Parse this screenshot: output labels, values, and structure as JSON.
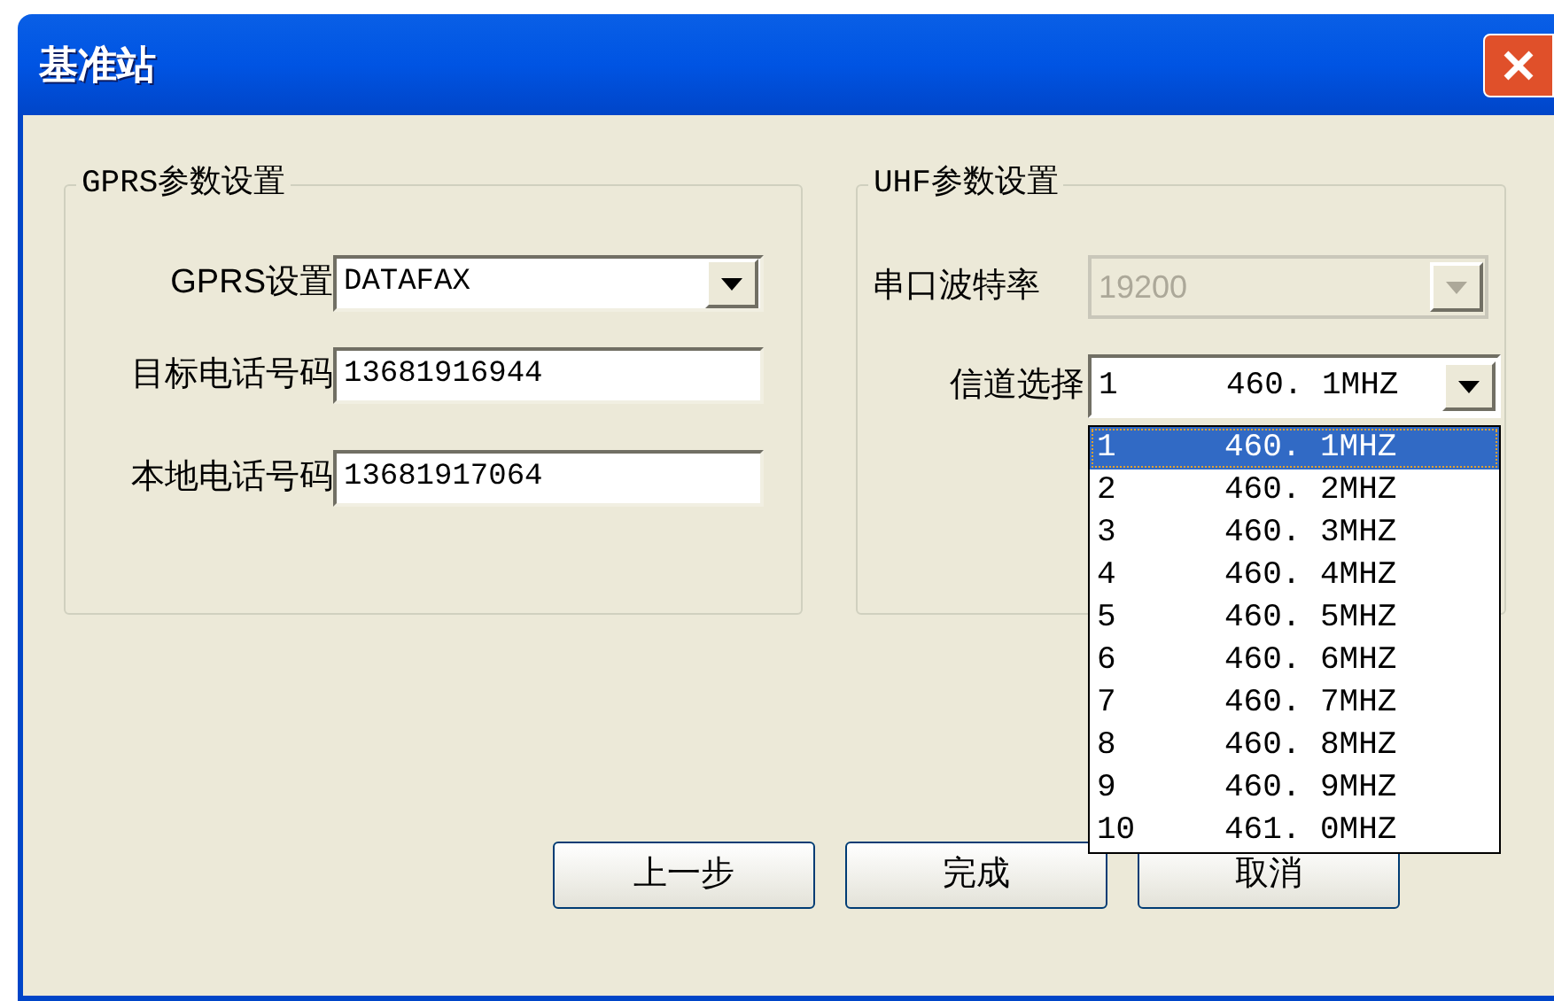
{
  "window": {
    "title": "基准站"
  },
  "gprs_group": {
    "title": "GPRS参数设置",
    "fields": [
      {
        "kind": "dropdown",
        "label": "GPRS设置",
        "value": "DATAFAX"
      },
      {
        "kind": "text",
        "label": "目标电话号码",
        "value": "13681916944"
      },
      {
        "kind": "text",
        "label": "本地电话号码",
        "value": "13681917064"
      }
    ]
  },
  "uhf_group": {
    "title": "UHF参数设置",
    "baud_rate": {
      "label": "串口波特率",
      "value": "19200",
      "disabled": true
    },
    "channel": {
      "label": "信道选择",
      "number": "1",
      "frequency": "460. 1MHZ",
      "expanded": true,
      "options": [
        {
          "number": "1",
          "frequency": "460. 1MHZ",
          "selected": true
        },
        {
          "number": "2",
          "frequency": "460. 2MHZ",
          "selected": false
        },
        {
          "number": "3",
          "frequency": "460. 3MHZ",
          "selected": false
        },
        {
          "number": "4",
          "frequency": "460. 4MHZ",
          "selected": false
        },
        {
          "number": "5",
          "frequency": "460. 5MHZ",
          "selected": false
        },
        {
          "number": "6",
          "frequency": "460. 6MHZ",
          "selected": false
        },
        {
          "number": "7",
          "frequency": "460. 7MHZ",
          "selected": false
        },
        {
          "number": "8",
          "frequency": "460. 8MHZ",
          "selected": false
        },
        {
          "number": "9",
          "frequency": "460. 9MHZ",
          "selected": false
        },
        {
          "number": "10",
          "frequency": "461. 0MHZ",
          "selected": false
        }
      ]
    }
  },
  "buttons": [
    "上一步",
    "完成",
    "取消"
  ]
}
